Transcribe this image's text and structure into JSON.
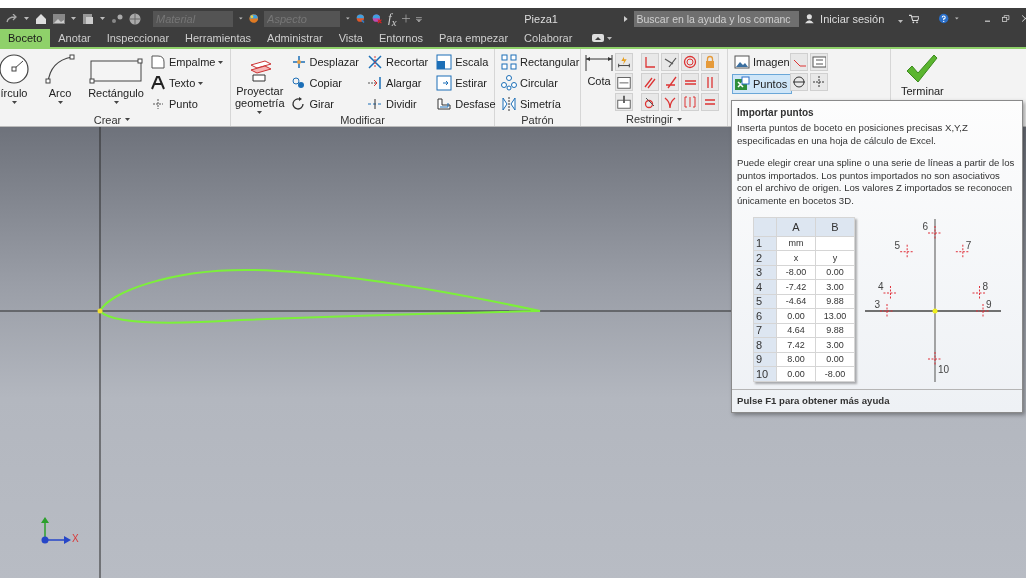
{
  "title_bar": {
    "material_field": {
      "placeholder": "Material"
    },
    "appearance_field": {
      "placeholder": "Aspecto"
    },
    "function_button": "f$_{x}$",
    "document_title": "Pieza1",
    "search": {
      "placeholder": "Buscar en la ayuda y los comanc"
    },
    "sign_in": "Iniciar sesión"
  },
  "tabs": [
    {
      "label": "Boceto",
      "selected": true
    },
    {
      "label": "Anotar",
      "selected": false
    },
    {
      "label": "Inspeccionar",
      "selected": false
    },
    {
      "label": "Herramientas",
      "selected": false
    },
    {
      "label": "Administrar",
      "selected": false
    },
    {
      "label": "Vista",
      "selected": false
    },
    {
      "label": "Entornos",
      "selected": false
    },
    {
      "label": "Para empezar",
      "selected": false
    },
    {
      "label": "Colaborar",
      "selected": false
    }
  ],
  "ribbon": {
    "create": {
      "label": "Crear",
      "menu": true,
      "large_tools": [
        {
          "label": "írculo",
          "dropdown": true
        },
        {
          "label": "Arco",
          "dropdown": true
        },
        {
          "label": "Rectángulo",
          "dropdown": true
        }
      ],
      "small_tools": [
        {
          "label": "Empalme",
          "dropdown": true
        },
        {
          "label": "Texto",
          "dropdown": true
        },
        {
          "label": "Punto",
          "dropdown": false
        }
      ]
    },
    "project": {
      "label": "Proyectar geometría",
      "dropdown": true
    },
    "modify": {
      "label": "Modificar",
      "menu": false,
      "tools": [
        "Desplazar",
        "Copiar",
        "Girar",
        "Recortar",
        "Alargar",
        "Dividir",
        "Escala",
        "Estirar",
        "Desfase"
      ]
    },
    "pattern": {
      "label": "Patrón",
      "menu": false,
      "tools": [
        "Rectangular",
        "Circular",
        "Simetría"
      ]
    },
    "constrain": {
      "label": "Restringir",
      "menu": true,
      "dimension": "Cota"
    },
    "insert": [
      {
        "label": "Imagen",
        "highlighted": false
      },
      {
        "label": "Puntos",
        "highlighted": true
      }
    ],
    "finish": "Terminar"
  },
  "canvas": {
    "x_axis_label": "X"
  },
  "tooltip": {
    "title": "Importar puntos",
    "paragraphs": [
      "Inserta puntos de boceto en posiciones precisas X,Y,Z especificadas en una hoja de cálculo de Excel.",
      "Puede elegir crear una spline o una serie de líneas a partir de los puntos importados. Los puntos importados no son asociativos con el archivo de origen. Los valores Z importados se reconocen únicamente en bocetos 3D."
    ],
    "sheet": {
      "columns": [
        "A",
        "B"
      ],
      "rows": [
        {
          "row": "1",
          "a": "mm"
        },
        {
          "row": "2",
          "a": "x",
          "b": "y"
        },
        {
          "row": "3",
          "a": "-8.00",
          "b": "0.00"
        },
        {
          "row": "4",
          "a": "-7.42",
          "b": "3.00"
        },
        {
          "row": "5",
          "a": "-4.64",
          "b": "9.88"
        },
        {
          "row": "6",
          "a": "0.00",
          "b": "13.00"
        },
        {
          "row": "7",
          "a": "4.64",
          "b": "9.88"
        },
        {
          "row": "8",
          "a": "7.42",
          "b": "3.00"
        },
        {
          "row": "9",
          "a": "8.00",
          "b": "0.00"
        },
        {
          "row": "10",
          "a": "0.00",
          "b": "-8.00"
        }
      ]
    },
    "diagram": {
      "point_labels": [
        "3",
        "4",
        "5",
        "6",
        "7",
        "8",
        "9",
        "10"
      ]
    },
    "footer": "Pulse F1 para obtener más ayuda"
  }
}
